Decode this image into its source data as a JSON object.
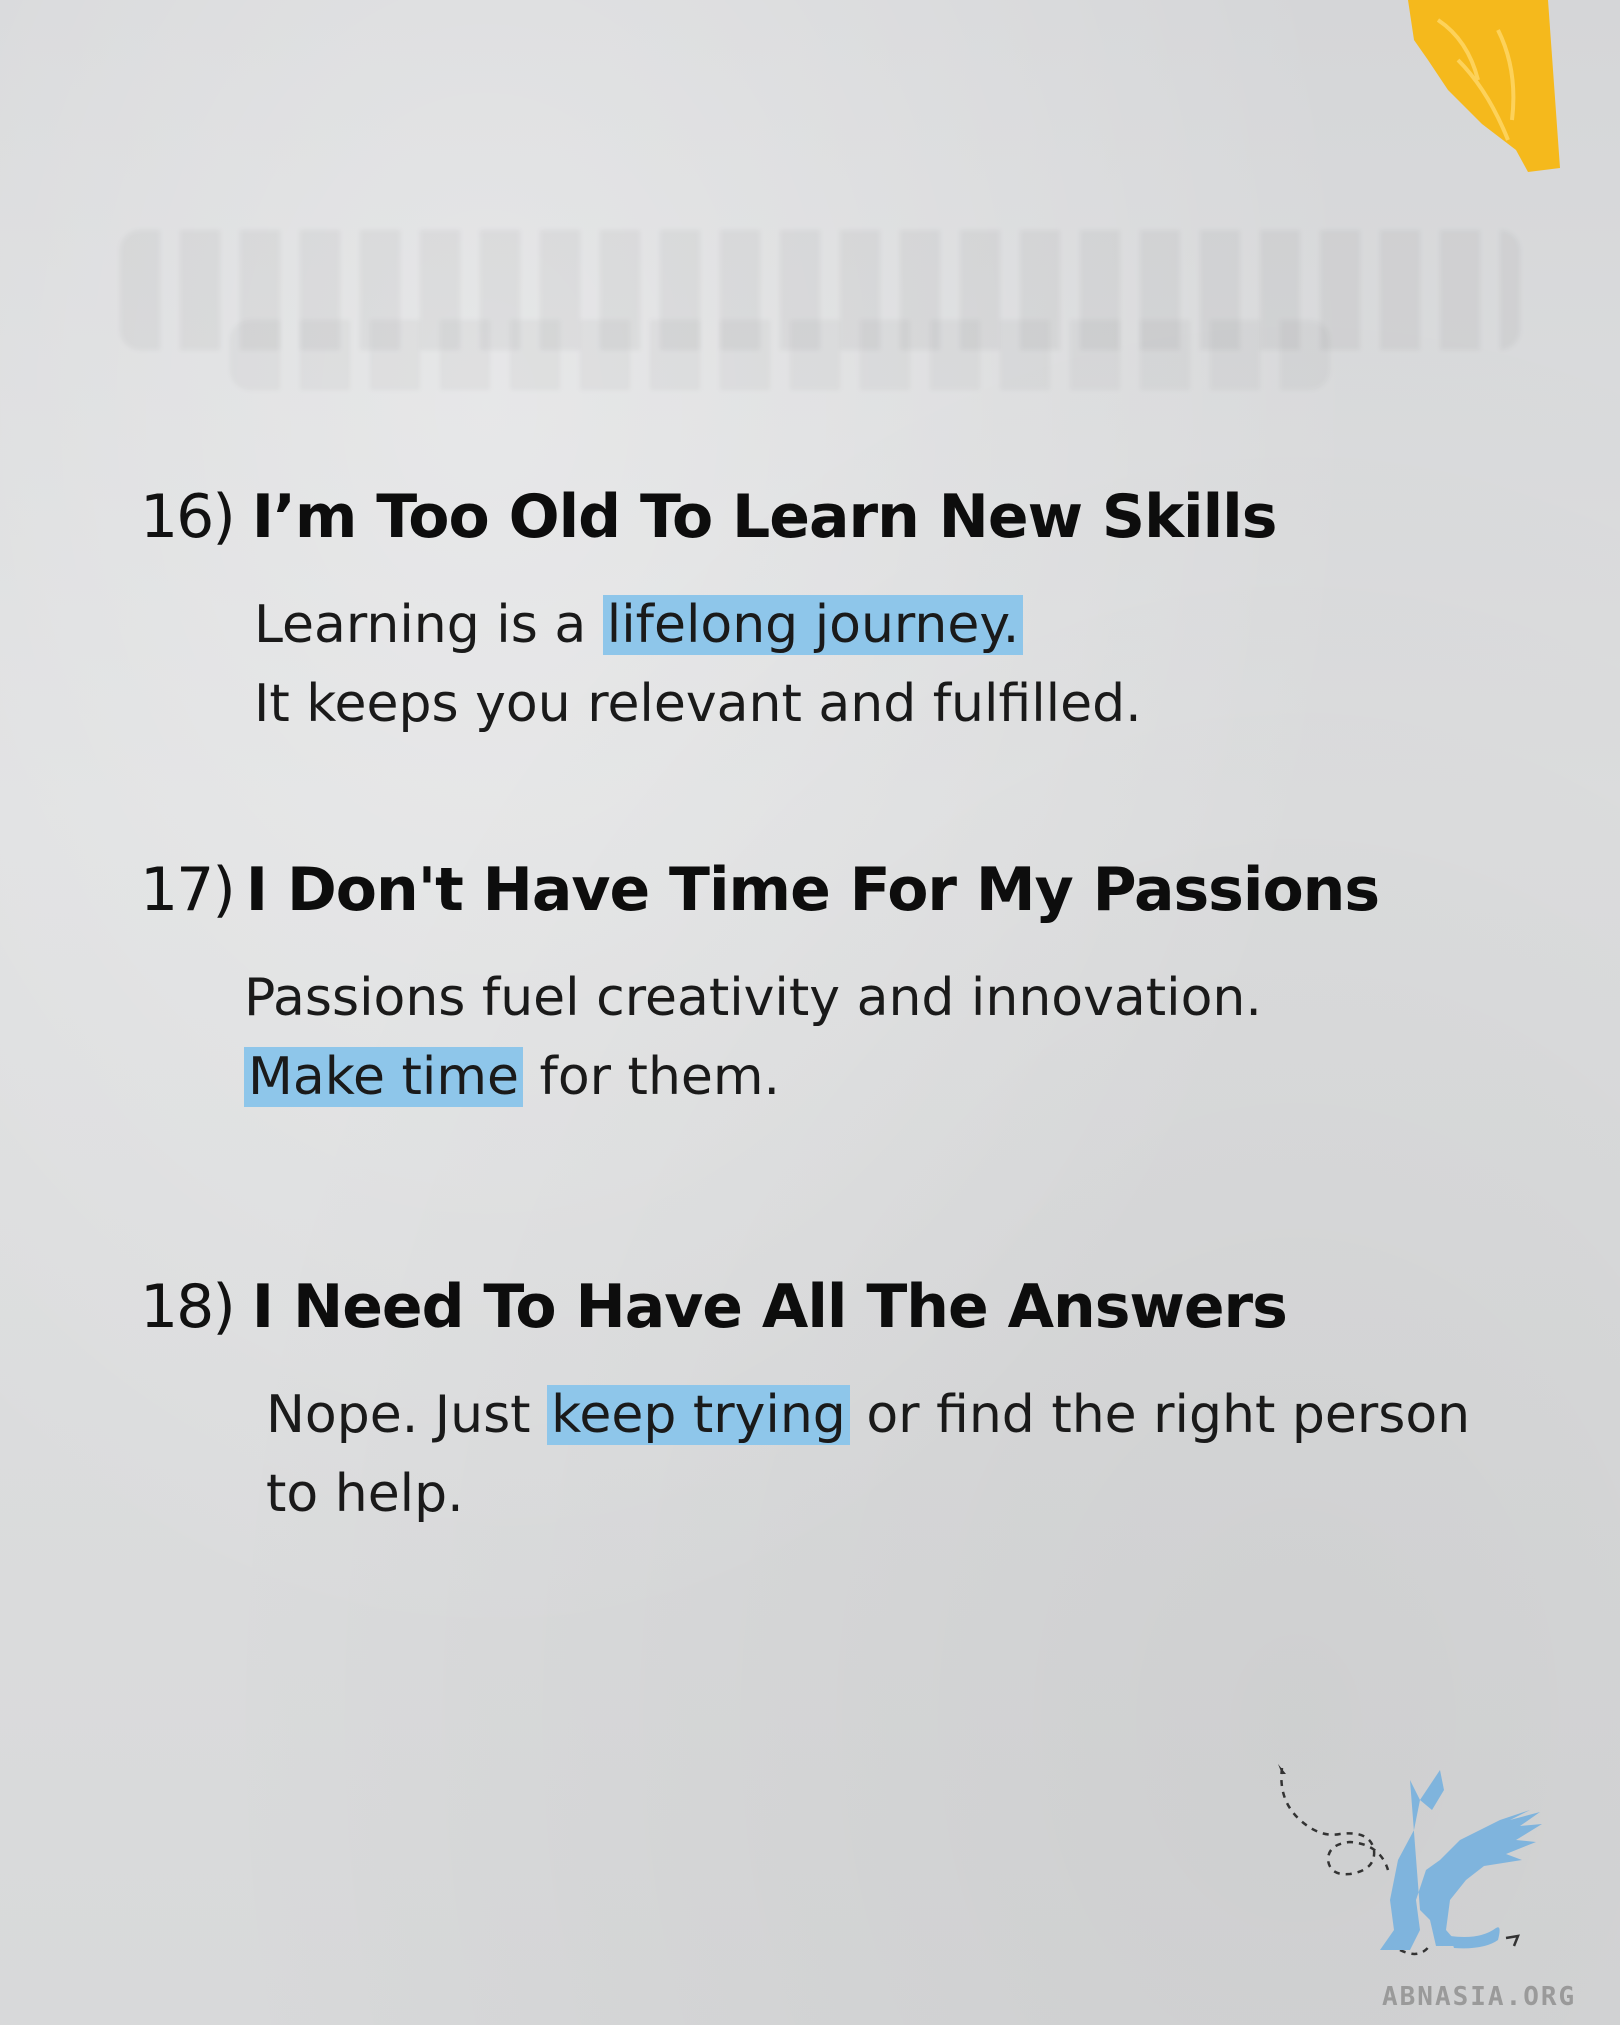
{
  "items": [
    {
      "number": "16)",
      "title": "I’m Too Old To Learn New Skills",
      "line1_before": "Learning is a ",
      "line1_highlight": "lifelong journey.",
      "line2": "It keeps you relevant and fulfilled."
    },
    {
      "number": "17)",
      "title": "I Don't Have Time For My Passions",
      "line1": "Passions fuel creativity and innovation.",
      "line2_highlight": "Make time",
      "line2_after": " for them."
    },
    {
      "number": "18)",
      "title": "I Need To Have All The Answers",
      "line1_before": "Nope. Just ",
      "line1_highlight": "keep trying",
      "line1_after": " or find the right person",
      "line2": "to help."
    }
  ],
  "branding": {
    "site": "ABNASIA.ORG",
    "logo_icon": "winged-griffin-icon"
  },
  "colors": {
    "highlight": "#8ec6ea",
    "tape": "#f5b91c",
    "logo": "#7fb4dd"
  }
}
